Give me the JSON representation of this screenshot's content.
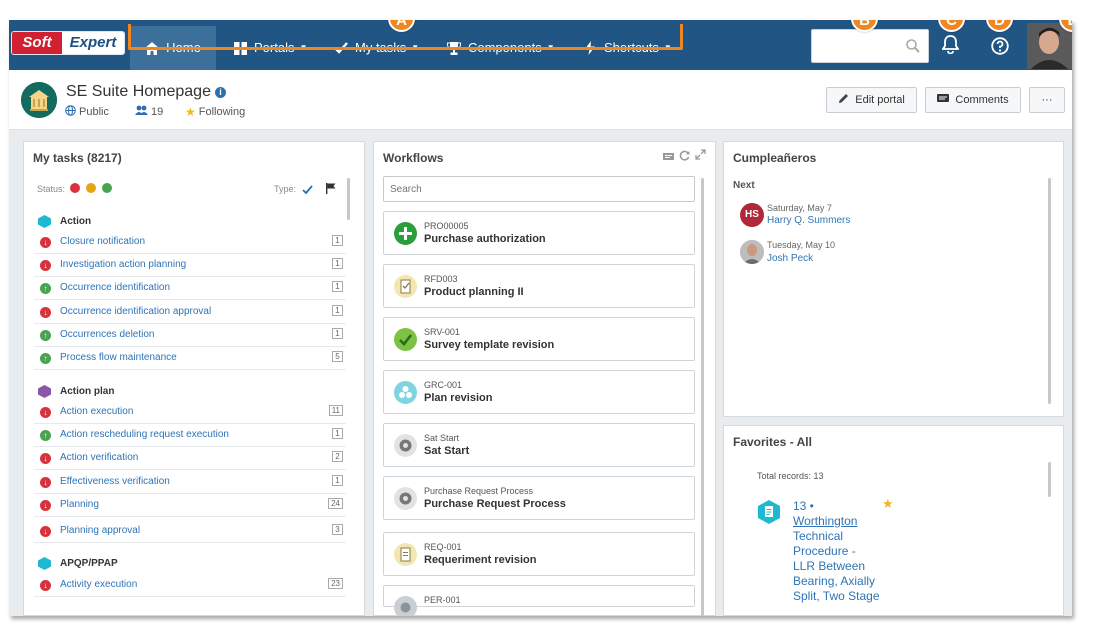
{
  "brand": {
    "logo_left": "Soft",
    "logo_right": "Expert",
    "nav_color": "#215684",
    "accent": "#f0861f"
  },
  "nav": {
    "home": "Home",
    "portals": "Portals",
    "tasks": "My tasks",
    "components": "Components",
    "shortcuts": "Shortcuts",
    "search_placeholder": ""
  },
  "callouts": {
    "a": "A",
    "b": "B",
    "c": "C",
    "d": "D",
    "e": "E"
  },
  "header": {
    "title": "SE Suite Homepage",
    "visibility": "Public",
    "followers": "19",
    "following": "Following",
    "edit_portal": "Edit portal",
    "comments": "Comments",
    "more": "···"
  },
  "tasks": {
    "title": "My tasks (8217)",
    "status_label": "Status:",
    "type_label": "Type:",
    "groups": [
      {
        "label": "Action",
        "color": "#1fb8d1"
      },
      {
        "label": "Action plan",
        "color": "#8a56a8"
      },
      {
        "label": "APQP/PPAP",
        "color": "#1fb8d1"
      }
    ],
    "items": [
      {
        "label": "Closure notification",
        "count": "1",
        "status": "red"
      },
      {
        "label": "Investigation action planning",
        "count": "1",
        "status": "red"
      },
      {
        "label": "Occurrence identification",
        "count": "1",
        "status": "green"
      },
      {
        "label": "Occurrence identification approval",
        "count": "1",
        "status": "red"
      },
      {
        "label": "Occurrences deletion",
        "count": "1",
        "status": "green"
      },
      {
        "label": "Process flow maintenance",
        "count": "5",
        "status": "green"
      },
      {
        "label": "Action execution",
        "count": "11",
        "status": "red"
      },
      {
        "label": "Action rescheduling request execution",
        "count": "1",
        "status": "green"
      },
      {
        "label": "Action verification",
        "count": "2",
        "status": "red"
      },
      {
        "label": "Effectiveness verification",
        "count": "1",
        "status": "red"
      },
      {
        "label": "Planning",
        "count": "24",
        "status": "red"
      },
      {
        "label": "Planning approval",
        "count": "3",
        "status": "red"
      },
      {
        "label": "Activity execution",
        "count": "23",
        "status": "red"
      }
    ]
  },
  "workflows": {
    "title": "Workflows",
    "search_placeholder": "Search",
    "items": [
      {
        "code": "PRO00005",
        "name": "Purchase authorization",
        "color": "#2a9d3c"
      },
      {
        "code": "RFD003",
        "name": "Product planning II",
        "color": "#f2e6b3"
      },
      {
        "code": "SRV-001",
        "name": "Survey template revision",
        "color": "#7cc343"
      },
      {
        "code": "GRC-001",
        "name": "Plan revision",
        "color": "#7fd4e0"
      },
      {
        "code": "Sat Start",
        "name": "Sat Start",
        "color": "#e2e2e2"
      },
      {
        "code": "Purchase Request Process",
        "name": "Purchase Request Process",
        "color": "#e2e2e2"
      },
      {
        "code": "REQ-001",
        "name": "Requeriment revision",
        "color": "#f2e6b3"
      },
      {
        "code": "PER-001",
        "name": "",
        "color": "#c9cfd4"
      }
    ]
  },
  "birthdays": {
    "title": "Cumpleañeros",
    "next_label": "Next",
    "people": [
      {
        "date": "Saturday, May 7",
        "name": "Harry Q. Summers",
        "initials": "HS"
      },
      {
        "date": "Tuesday, May 10",
        "name": "Josh Peck",
        "initials": ""
      }
    ]
  },
  "favorites": {
    "title": "Favorites - All",
    "total": "Total records: 13",
    "line1": "13 •",
    "line2": "Worthington",
    "line3": "Technical",
    "line4": "Procedure -",
    "line5": "LLR Between",
    "line6": "Bearing, Axially",
    "line7": "Split, Two Stage"
  }
}
